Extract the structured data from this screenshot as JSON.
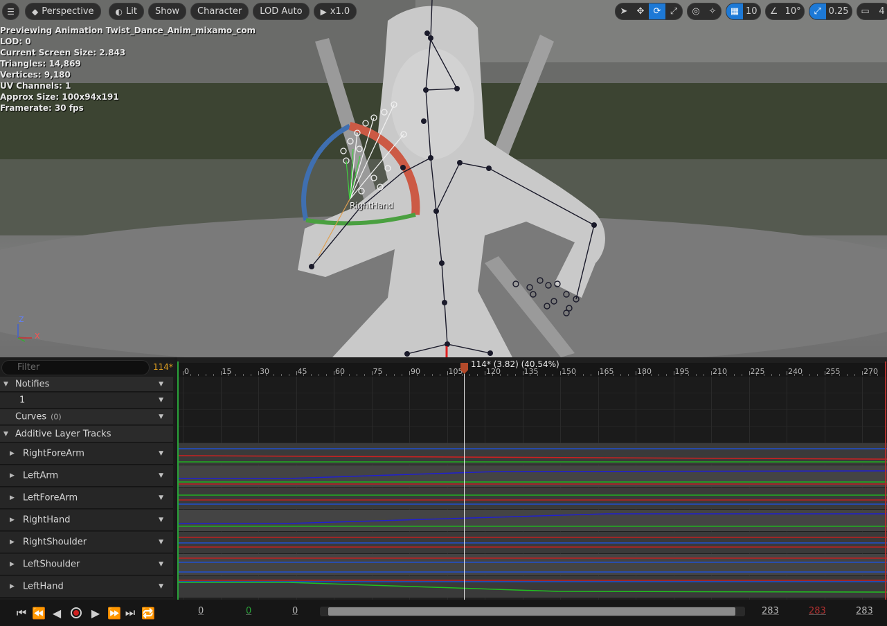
{
  "viewport": {
    "menu_icon": "hamburger-icon",
    "perspective_label": "Perspective",
    "lit_label": "Lit",
    "show_label": "Show",
    "character_label": "Character",
    "lod_label": "LOD Auto",
    "play_speed_label": "x1.0",
    "grid_snap_value": "10",
    "rotation_snap_value": "10°",
    "scale_snap_value": "0.25",
    "camera_speed_value": "4",
    "accent_color": "#1d79d6",
    "bone_label": "RightHand",
    "axis_z": "Z",
    "axis_x": "X",
    "stats": [
      "Previewing Animation Twist_Dance_Anim_mixamo_com",
      "LOD: 0",
      "Current Screen Size: 2.843",
      "Triangles: 14,869",
      "Vertices: 9,180",
      "UV Channels: 1",
      "Approx Size: 100x94x191",
      "Framerate: 30 fps"
    ]
  },
  "tracks_panel": {
    "filter_placeholder": "Filter",
    "current_frame": "114*",
    "notifies_label": "Notifies",
    "notify_track_label": "1",
    "curves_label": "Curves",
    "curves_count": "(0)",
    "additive_label": "Additive Layer Tracks",
    "tracks": [
      "RightForeArm",
      "LeftArm",
      "LeftForeArm",
      "RightHand",
      "RightShoulder",
      "LeftShoulder",
      "LeftHand"
    ]
  },
  "timeline": {
    "ticks": [
      "0",
      "15",
      "30",
      "45",
      "60",
      "75",
      "90",
      "105",
      "120",
      "135",
      "150",
      "165",
      "180",
      "195",
      "210",
      "225",
      "240",
      "255",
      "270"
    ],
    "playhead_label": "114* (3.82) (40.54%)",
    "playhead_frame": 114,
    "total_frames": 283
  },
  "transport": {
    "view_start": "0",
    "play_start": "0",
    "selection_start": "0",
    "view_end": "283",
    "play_end": "283",
    "selection_end": "283",
    "play_start_color": "#2aa23a",
    "play_end_color": "#b03030"
  }
}
